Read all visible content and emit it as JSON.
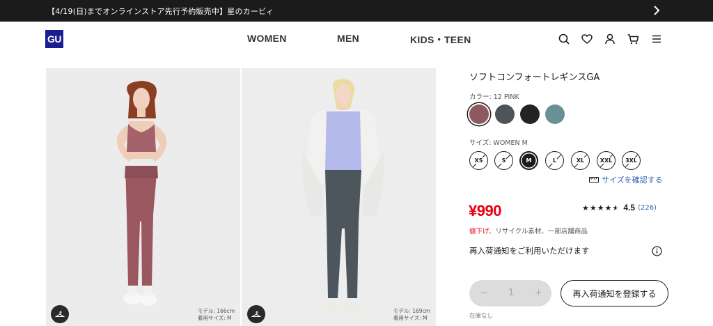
{
  "announcement": {
    "text": "【4/19(日)までオンラインストア先行予約販売中】星のカービィ",
    "chevron_icon": "chevron-right-icon"
  },
  "header": {
    "logo": "GU",
    "nav": [
      "WOMEN",
      "MEN",
      "KIDS・TEEN"
    ],
    "icons": [
      "search-icon",
      "heart-icon",
      "user-icon",
      "cart-icon",
      "menu-icon"
    ]
  },
  "gallery": [
    {
      "model_height": "モデル: 166cm",
      "model_size": "着用サイズ: M",
      "button_icon": "hanger-icon"
    },
    {
      "model_height": "モデル: 169cm",
      "model_size": "着用サイズ: M",
      "button_icon": "hanger-icon"
    }
  ],
  "product": {
    "title": "ソフトコンフォートレギンスGA",
    "color_label": "カラー: 12 PINK",
    "colors": [
      {
        "hex": "#8d5a62",
        "selected": true
      },
      {
        "hex": "#4f5459",
        "selected": false
      },
      {
        "hex": "#232323",
        "selected": false
      },
      {
        "hex": "#6b9094",
        "selected": false
      }
    ],
    "size_label": "サイズ: WOMEN M",
    "sizes": [
      {
        "label": "XS",
        "available": false,
        "selected": false
      },
      {
        "label": "S",
        "available": false,
        "selected": false
      },
      {
        "label": "M",
        "available": true,
        "selected": true
      },
      {
        "label": "L",
        "available": false,
        "selected": false
      },
      {
        "label": "XL",
        "available": false,
        "selected": false
      },
      {
        "label": "XXL",
        "available": false,
        "selected": false
      },
      {
        "label": "3XL",
        "available": false,
        "selected": false
      }
    ],
    "size_guide": "サイズを確認する",
    "price": "¥990",
    "rating_value": "4.5",
    "rating_stars": 4.5,
    "rating_count": "(226)",
    "badge_sale": "値下げ",
    "badge_rest": "、リサイクル素材、一部店舗商品",
    "restock_notice": "再入荷通知をご利用いただけます",
    "quantity": "1",
    "qty_minus": "−",
    "qty_plus": "+",
    "restock_button": "再入荷通知を登録する",
    "stock_note": "在庫なし"
  },
  "colors": {
    "brand_blue": "#1a1e8f",
    "price_red": "#e60012",
    "link_blue": "#3466b3"
  }
}
